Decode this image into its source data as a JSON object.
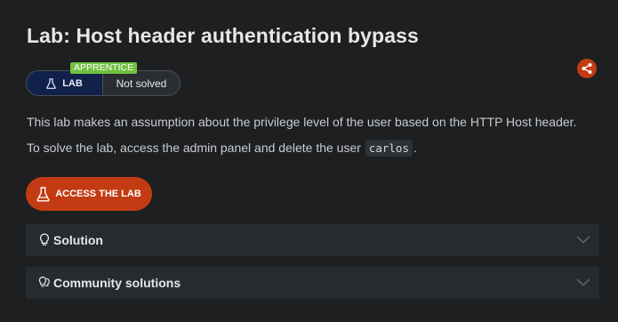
{
  "header": {
    "title": "Lab: Host header authentication bypass"
  },
  "status": {
    "level_badge": "APPRENTICE",
    "lab_label": "LAB",
    "solved_label": "Not solved"
  },
  "description": {
    "line1": "This lab makes an assumption about the privilege level of the user based on the HTTP Host header.",
    "line2_prefix": "To solve the lab, access the admin panel and delete the user",
    "line2_code": "carlos",
    "line2_suffix": "."
  },
  "actions": {
    "access_label": "ACCESS THE LAB"
  },
  "accordions": [
    {
      "label": "Solution",
      "icon": "lightbulb-icon"
    },
    {
      "label": "Community solutions",
      "icon": "lightbulbs-icon"
    }
  ],
  "colors": {
    "accent": "#c23b12",
    "lab_bg": "#10214a",
    "apprentice": "#70c140",
    "background": "#1d1f21",
    "panel": "#262b2f"
  }
}
